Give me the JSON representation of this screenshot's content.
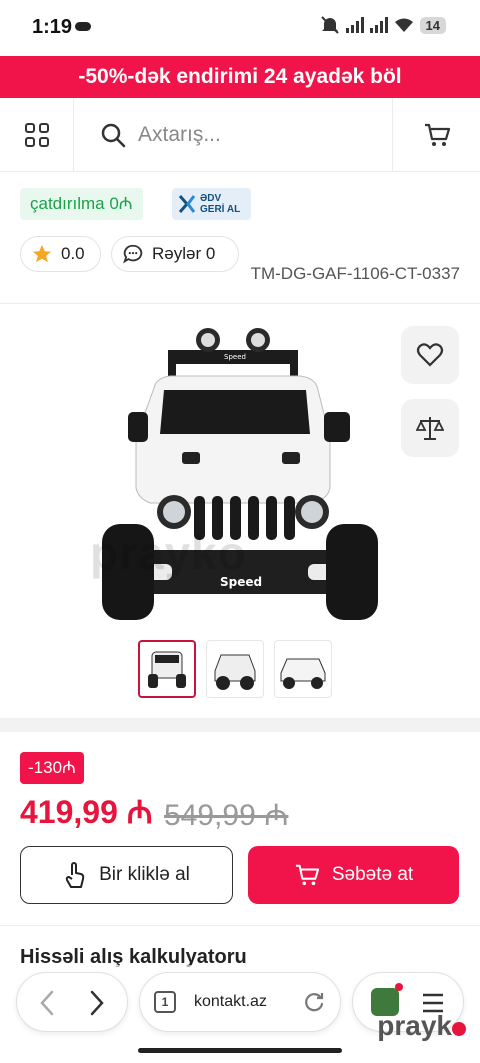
{
  "status_bar": {
    "time": "1:19",
    "battery": "14"
  },
  "promo_banner": {
    "text": "-50%-dək endirimi 24 ayadək böl"
  },
  "header": {
    "search_placeholder": "Axtarış..."
  },
  "badges": {
    "delivery": "çatdırılma 0₼",
    "edv_line1": "ƏDV",
    "edv_line2": "GERİ AL"
  },
  "product": {
    "rating": "0.0",
    "reviews": "Rəylər 0",
    "sku": "TM-DG-GAF-1106-CT-0337",
    "discount": "-130₼",
    "price": "419,99 ₼",
    "old_price": "549,99 ₼",
    "car_label": "Speed",
    "image_watermark": "prayko"
  },
  "actions": {
    "one_click": "Bir kliklə al",
    "add_to_cart": "Səbətə at"
  },
  "section": {
    "calculator_title": "Hissəli alış kalkulyatoru"
  },
  "browser": {
    "url": "kontakt.az",
    "tab_count": "1"
  },
  "watermark": "prayk",
  "colors": {
    "brand": "#f0144a",
    "price": "#e8143e",
    "delivery_green": "#1aa34a"
  }
}
